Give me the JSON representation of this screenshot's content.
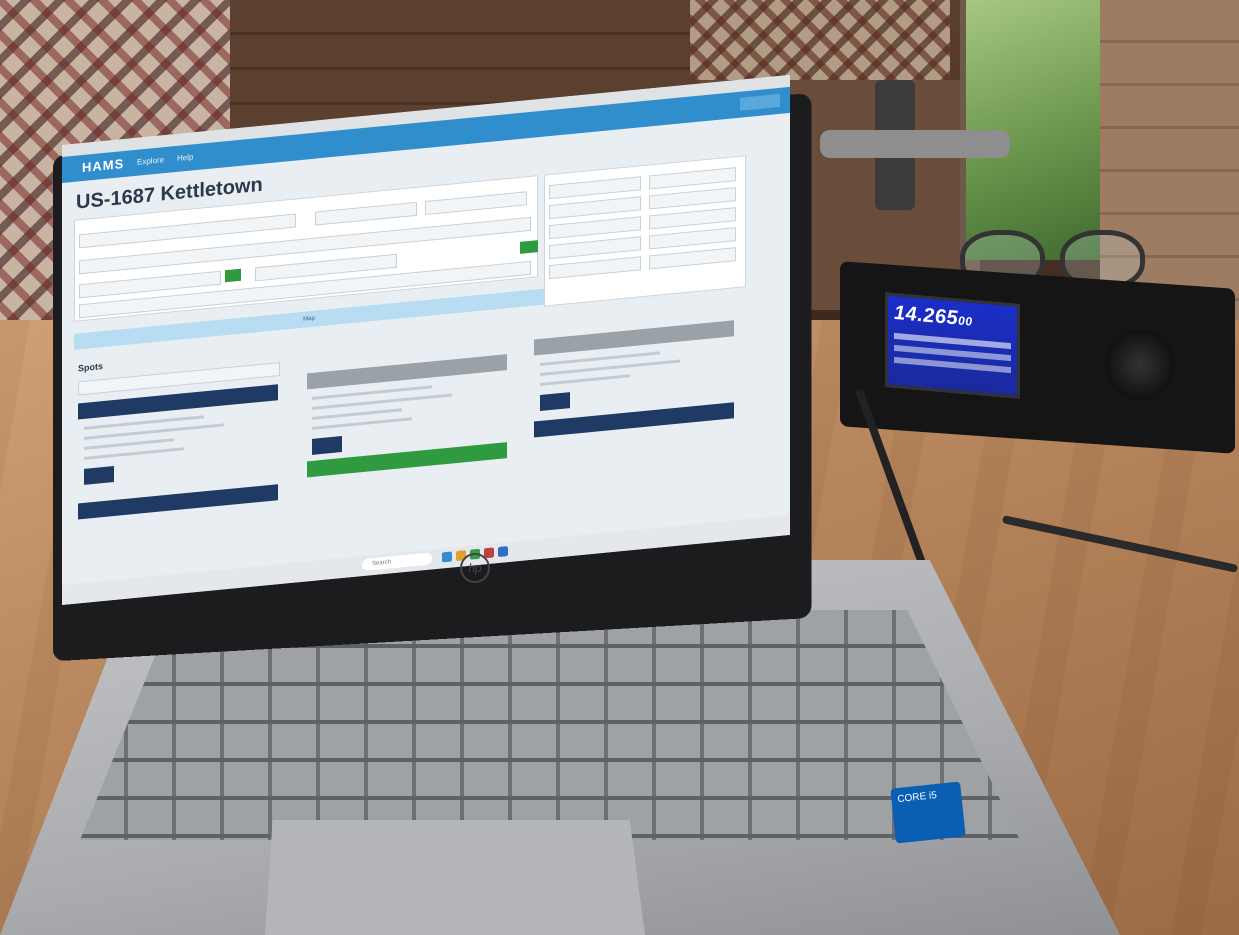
{
  "app": {
    "brand": "HAMS",
    "nav_links": [
      "Explore",
      "Help"
    ],
    "park_title": "US-1687 Kettletown"
  },
  "screen": {
    "section_bar": "Map",
    "spots_label": "Spots",
    "cards": [
      {
        "head_color": "#1f3a64"
      },
      {
        "head_color": "#9aa2a8"
      },
      {
        "head_color": "#9aa2a8"
      },
      {
        "head_color": "#2f9a3f"
      },
      {
        "head_color": "#1f3a64"
      },
      {
        "head_color": "#1f3a64"
      }
    ],
    "taskbar_search": "Search"
  },
  "radio": {
    "frequency": "14.265",
    "frequency_suffix": "00",
    "display_color": "#1a2ec8"
  },
  "laptop": {
    "intel_badge": "CORE i5"
  }
}
